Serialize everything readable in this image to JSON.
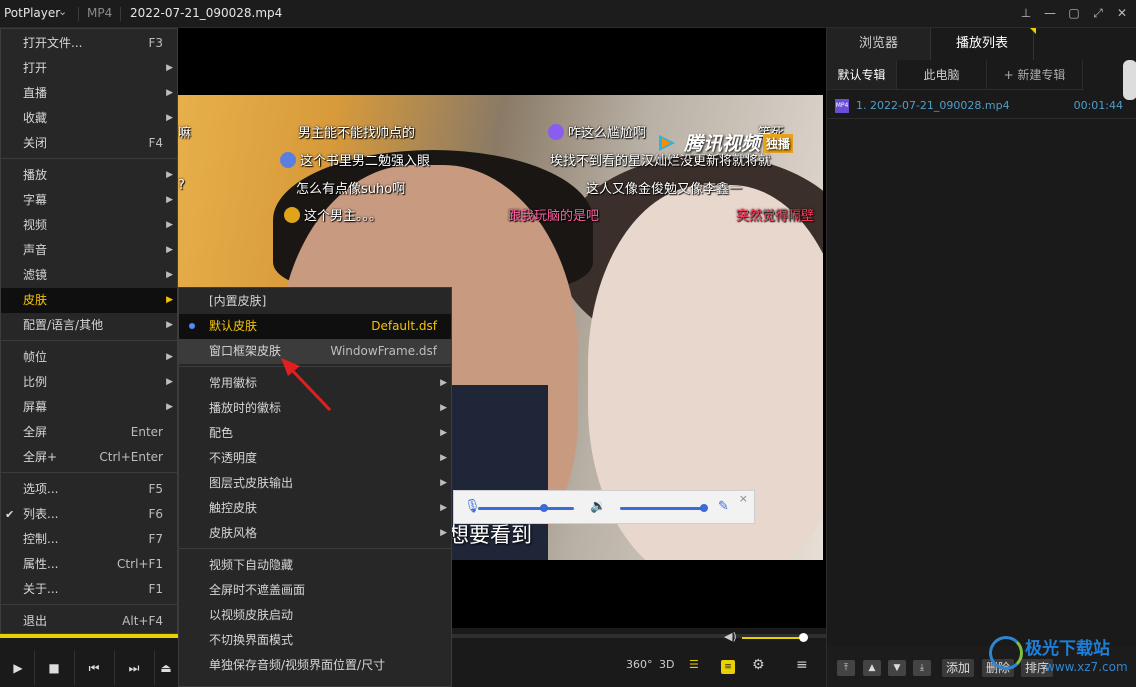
{
  "titlebar": {
    "app_name": "PotPlayer",
    "format": "MP4",
    "filename": "2022-07-21_090028.mp4",
    "chevron_icon": "chevron-down-icon",
    "window_buttons": [
      "pin-icon",
      "minimize-icon",
      "maximize-icon",
      "fullscreen-icon",
      "close-icon"
    ]
  },
  "video": {
    "danmaku": [
      {
        "text": "嘛"
      },
      {
        "text": "男主能不能找帅点的"
      },
      {
        "text": "咋这么尴尬啊"
      },
      {
        "text": "笑死"
      },
      {
        "text": "这个书里男二勉强入眼"
      },
      {
        "text": "埃找不到看的星汉灿烂没更新将就将就"
      },
      {
        "text": "怎么有点像suho啊"
      },
      {
        "text": "这人又像金俊勉又像李鑫一"
      },
      {
        "text": "?"
      },
      {
        "text": "这个男主。。。"
      },
      {
        "text": "跟我玩脑的是吧"
      },
      {
        "text": "突然觉得隔壁"
      }
    ],
    "watermark": "腾讯视频",
    "watermark_tag": "独播",
    "subtitle": "想要看到"
  },
  "mini_controls": {
    "mic_icon": "microphone-icon",
    "speaker_icon": "speaker-icon",
    "edit_icon": "pencil-icon",
    "close_icon": "close-icon",
    "mic_level": 0.6,
    "volume_level": 1.0
  },
  "menu": {
    "items": [
      {
        "label": "打开文件...",
        "shortcut": "F3"
      },
      {
        "label": "打开"
      },
      {
        "label": "直播"
      },
      {
        "label": "收藏"
      },
      {
        "label": "关闭",
        "shortcut": "F4"
      },
      {
        "label": "播放"
      },
      {
        "label": "字幕"
      },
      {
        "label": "视频"
      },
      {
        "label": "声音"
      },
      {
        "label": "滤镜"
      },
      {
        "label": "皮肤"
      },
      {
        "label": "配置/语言/其他"
      },
      {
        "label": "帧位"
      },
      {
        "label": "比例"
      },
      {
        "label": "屏幕"
      },
      {
        "label": "全屏",
        "shortcut": "Enter"
      },
      {
        "label": "全屏+",
        "shortcut": "Ctrl+Enter"
      },
      {
        "label": "选项...",
        "shortcut": "F5"
      },
      {
        "label": "列表...",
        "shortcut": "F6"
      },
      {
        "label": "控制...",
        "shortcut": "F7"
      },
      {
        "label": "属性...",
        "shortcut": "Ctrl+F1"
      },
      {
        "label": "关于...",
        "shortcut": "F1"
      },
      {
        "label": "退出",
        "shortcut": "Alt+F4"
      }
    ],
    "checked_label": "列表...",
    "highlighted_label": "皮肤"
  },
  "submenu": {
    "items": [
      {
        "label": "[内置皮肤]"
      },
      {
        "label": "默认皮肤",
        "value": "Default.dsf"
      },
      {
        "label": "窗口框架皮肤",
        "value": "WindowFrame.dsf"
      },
      {
        "label": "常用徽标"
      },
      {
        "label": "播放时的徽标"
      },
      {
        "label": "配色"
      },
      {
        "label": "不透明度"
      },
      {
        "label": "图层式皮肤输出"
      },
      {
        "label": "触控皮肤"
      },
      {
        "label": "皮肤风格"
      },
      {
        "label": "视频下自动隐藏"
      },
      {
        "label": "全屏时不遮盖画面"
      },
      {
        "label": "以视频皮肤启动"
      },
      {
        "label": "不切换界面模式"
      },
      {
        "label": "单独保存音频/视频界面位置/尺寸"
      }
    ],
    "selected_label": "默认皮肤"
  },
  "player": {
    "seek_progress": 0.22,
    "volume_level": 1.0,
    "buttons": [
      "play-icon",
      "stop-icon",
      "previous-icon",
      "next-icon",
      "eject-icon"
    ],
    "toolbar": {
      "btn_360": "360°",
      "btn_3d": "3D",
      "icons": [
        "playlist-search-icon",
        "subtitle-icon",
        "settings-gear-icon",
        "menu-icon"
      ]
    }
  },
  "panel": {
    "tabs": [
      "浏览器",
      "播放列表"
    ],
    "active_tab": "播放列表",
    "subtabs": [
      "默认专辑",
      "此电脑",
      "+ 新建专辑"
    ],
    "playlist": [
      {
        "index": "1.",
        "title": "2022-07-21_090028.mp4",
        "duration": "00:01:44",
        "icon": "MP4"
      }
    ],
    "bottom_icons": [
      "move-top-icon",
      "move-up-icon",
      "move-down-icon",
      "move-bottom-icon"
    ],
    "bottom_buttons": [
      "添加",
      "删除",
      "排序"
    ],
    "search_icon": "search-icon"
  },
  "watermark_badge": {
    "title": "极光下载站",
    "url": "www.xz7.com"
  },
  "colors": {
    "accent": "#e9d000",
    "menu_highlight": "#f6c400",
    "selected_dot": "#4f8bff",
    "playlist_text": "#4f9ec8",
    "annotation_arrow": "#e02020"
  }
}
